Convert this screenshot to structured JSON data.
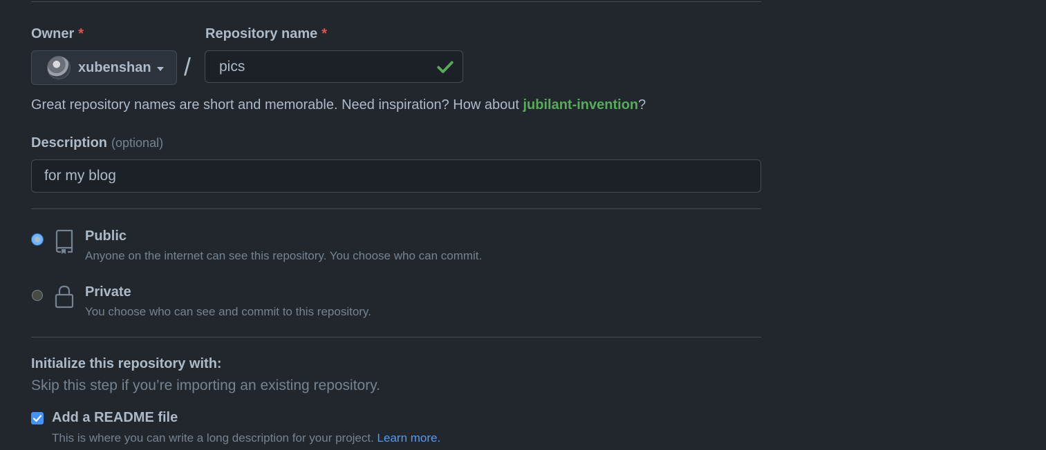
{
  "owner": {
    "label": "Owner",
    "required_mark": "*",
    "name": "xubenshan",
    "avatar_icon": "avatar"
  },
  "separator": "/",
  "repository": {
    "label": "Repository name",
    "required_mark": "*",
    "value": "pics",
    "status_icon": "check-icon"
  },
  "hint": {
    "text": "Great repository names are short and memorable. Need inspiration? How about ",
    "suggestion": "jubilant-invention",
    "suffix": "?"
  },
  "description": {
    "label": "Description",
    "optional": "(optional)",
    "value": "for my blog"
  },
  "visibility": {
    "options": [
      {
        "title": "Public",
        "desc": "Anyone on the internet can see this repository. You choose who can commit.",
        "icon": "repo-icon",
        "selected": true
      },
      {
        "title": "Private",
        "desc": "You choose who can see and commit to this repository.",
        "icon": "lock-icon",
        "selected": false
      }
    ]
  },
  "initialize": {
    "title": "Initialize this repository with:",
    "subtitle": "Skip this step if you’re importing an existing repository.",
    "readme": {
      "label": "Add a README file",
      "desc": "This is where you can write a long description for your project. ",
      "link": "Learn more.",
      "checked": true
    }
  },
  "colors": {
    "background": "#22272e",
    "accent": "#539bf5",
    "success": "#57ab5a",
    "danger": "#e5534b"
  }
}
